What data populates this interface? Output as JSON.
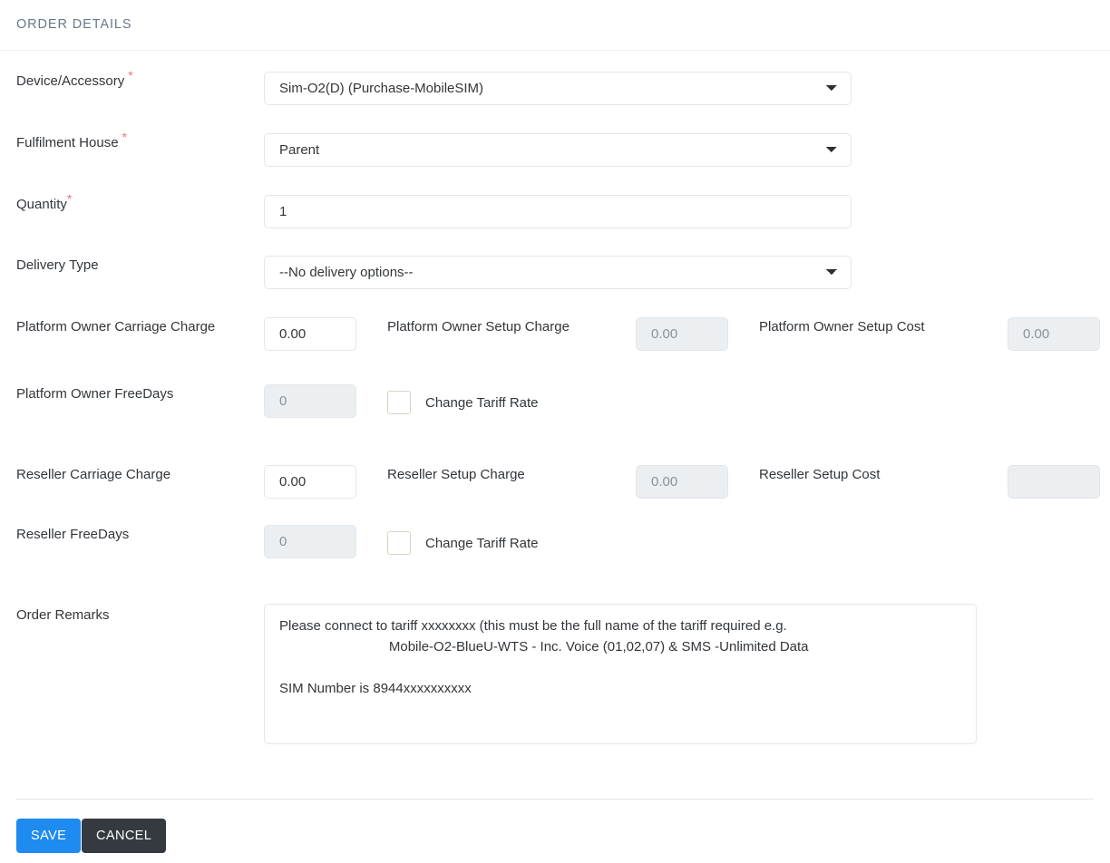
{
  "section": {
    "title": "ORDER DETAILS"
  },
  "colors": {
    "header_text": "#66798a",
    "required_asterisk": "#f8707f",
    "save_button": "#1d8bef",
    "cancel_button": "#343a40",
    "field_border": "#e3e6ea",
    "disabled_field_bg": "#eceff1"
  },
  "fields": {
    "device_accessory": {
      "label": "Device/Accessory",
      "required": true,
      "value": "Sim-O2(D) (Purchase-MobileSIM)",
      "type": "select"
    },
    "fulfilment_house": {
      "label": "Fulfilment House",
      "required": true,
      "value": "Parent",
      "type": "select"
    },
    "quantity": {
      "label": "Quantity",
      "required": true,
      "value": "1",
      "type": "text"
    },
    "delivery_type": {
      "label": "Delivery Type",
      "required": false,
      "value": "--No delivery options--",
      "type": "select"
    },
    "platform_owner_carriage_charge": {
      "label": "Platform Owner Carriage Charge",
      "value": "0.00",
      "disabled": false
    },
    "platform_owner_setup_charge": {
      "label": "Platform Owner Setup Charge",
      "value": "0.00",
      "disabled": true
    },
    "platform_owner_setup_cost": {
      "label": "Platform Owner Setup Cost",
      "value": "0.00",
      "disabled": true
    },
    "platform_owner_freedays": {
      "label": "Platform Owner FreeDays",
      "value": "0",
      "disabled": true
    },
    "platform_owner_change_tariff_rate": {
      "label": "Change Tariff Rate",
      "checked": false
    },
    "reseller_carriage_charge": {
      "label": "Reseller Carriage Charge",
      "value": "0.00",
      "disabled": false
    },
    "reseller_setup_charge": {
      "label": "Reseller Setup Charge",
      "value": "0.00",
      "disabled": true
    },
    "reseller_setup_cost": {
      "label": "Reseller Setup Cost",
      "value": "",
      "disabled": true
    },
    "reseller_freedays": {
      "label": "Reseller FreeDays",
      "value": "0",
      "disabled": true
    },
    "reseller_change_tariff_rate": {
      "label": "Change Tariff Rate",
      "checked": false
    },
    "order_remarks": {
      "label": "Order Remarks",
      "value": "Please connect to tariff xxxxxxxx (this must be the full name of the tariff required e.g.\n                             Mobile-O2-BlueU-WTS - Inc. Voice (01,02,07) & SMS -Unlimited Data\n\nSIM Number is 8944xxxxxxxxxx"
    }
  },
  "footer": {
    "save_label": "SAVE",
    "cancel_label": "CANCEL"
  }
}
